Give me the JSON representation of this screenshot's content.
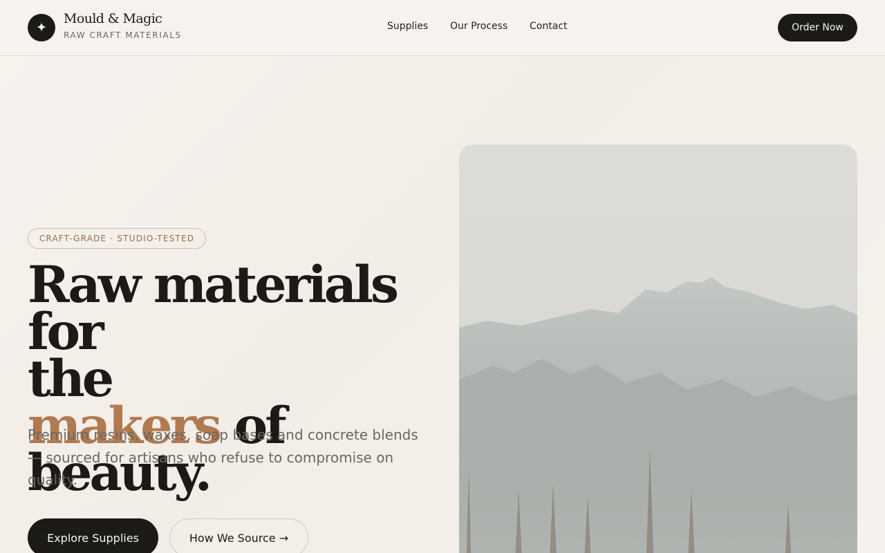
{
  "brand": {
    "name": "Mould & Magic",
    "tagline": "RAW CRAFT MATERIALS",
    "logo_icon": "sparkle-icon"
  },
  "nav": {
    "items": [
      {
        "label": "Supplies"
      },
      {
        "label": "Our Process"
      },
      {
        "label": "Contact"
      }
    ],
    "cta_label": "Order Now"
  },
  "hero": {
    "badge": "CRAFT-GRADE · STUDIO-TESTED",
    "headline_line1": "Raw materials for",
    "headline_line2": "the",
    "headline_accent": "makers",
    "headline_rest": " of beauty.",
    "subcopy": "Premium resins, waxes, soap bases and concrete blends — sourced for artisans who refuse to compromise on quality.",
    "primary_button": "Explore Supplies",
    "secondary_button": "How We Source →"
  },
  "colors": {
    "ink": "#1c1a17",
    "accent": "#b07a51",
    "muted": "#6b6660",
    "background": "#f4efe9"
  }
}
